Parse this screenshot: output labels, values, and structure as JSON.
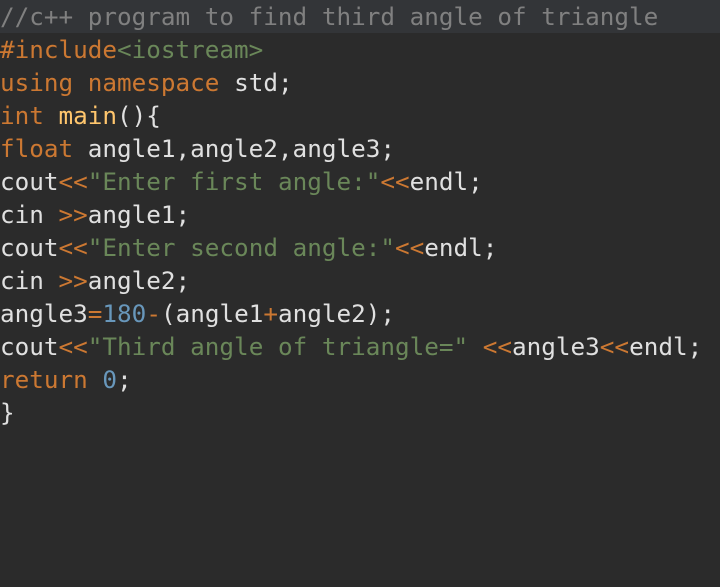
{
  "editor": {
    "colors": {
      "background": "#2b2b2b",
      "comment_line_bg": "#333538",
      "keyword": "#cc7832",
      "directive": "#cc7832",
      "header": "#6a8759",
      "string": "#6a8759",
      "number": "#6897bb",
      "operator": "#cc7832",
      "function": "#ffc66d",
      "comment": "#808080",
      "plain": "#e0e0e0"
    },
    "lines": [
      {
        "kind": "comment",
        "tokens": [
          {
            "t": "//c++ program to find third angle of triangle",
            "c": "comment"
          }
        ]
      },
      {
        "kind": "code",
        "tokens": [
          {
            "t": "#include",
            "c": "directive"
          },
          {
            "t": "<iostream>",
            "c": "header"
          }
        ]
      },
      {
        "kind": "code",
        "tokens": [
          {
            "t": "using",
            "c": "keyword"
          },
          {
            "t": " ",
            "c": "plain"
          },
          {
            "t": "namespace",
            "c": "keyword"
          },
          {
            "t": " std;",
            "c": "plain"
          }
        ]
      },
      {
        "kind": "code",
        "tokens": [
          {
            "t": "int",
            "c": "keyword"
          },
          {
            "t": " ",
            "c": "plain"
          },
          {
            "t": "main",
            "c": "function"
          },
          {
            "t": "(){",
            "c": "plain"
          }
        ]
      },
      {
        "kind": "code",
        "tokens": [
          {
            "t": "float",
            "c": "keyword"
          },
          {
            "t": " angle1,angle2,angle3;",
            "c": "plain"
          }
        ]
      },
      {
        "kind": "code",
        "tokens": [
          {
            "t": "cout",
            "c": "plain"
          },
          {
            "t": "<<",
            "c": "operator"
          },
          {
            "t": "\"Enter first angle:\"",
            "c": "string"
          },
          {
            "t": "<<",
            "c": "operator"
          },
          {
            "t": "endl;",
            "c": "plain"
          }
        ]
      },
      {
        "kind": "code",
        "tokens": [
          {
            "t": "cin ",
            "c": "plain"
          },
          {
            "t": ">>",
            "c": "operator"
          },
          {
            "t": "angle1;",
            "c": "plain"
          }
        ]
      },
      {
        "kind": "code",
        "tokens": [
          {
            "t": "cout",
            "c": "plain"
          },
          {
            "t": "<<",
            "c": "operator"
          },
          {
            "t": "\"Enter second angle:\"",
            "c": "string"
          },
          {
            "t": "<<",
            "c": "operator"
          },
          {
            "t": "endl;",
            "c": "plain"
          }
        ]
      },
      {
        "kind": "code",
        "tokens": [
          {
            "t": "cin ",
            "c": "plain"
          },
          {
            "t": ">>",
            "c": "operator"
          },
          {
            "t": "angle2;",
            "c": "plain"
          }
        ]
      },
      {
        "kind": "code",
        "tokens": [
          {
            "t": "angle3",
            "c": "plain"
          },
          {
            "t": "=",
            "c": "operator"
          },
          {
            "t": "180",
            "c": "number"
          },
          {
            "t": "-",
            "c": "operator"
          },
          {
            "t": "(angle1",
            "c": "plain"
          },
          {
            "t": "+",
            "c": "operator"
          },
          {
            "t": "angle2);",
            "c": "plain"
          }
        ]
      },
      {
        "kind": "code",
        "tokens": [
          {
            "t": "cout",
            "c": "plain"
          },
          {
            "t": "<<",
            "c": "operator"
          },
          {
            "t": "\"Third angle of triangle=\"",
            "c": "string"
          },
          {
            "t": " ",
            "c": "plain"
          },
          {
            "t": "<<",
            "c": "operator"
          },
          {
            "t": "angle3",
            "c": "plain"
          },
          {
            "t": "<<",
            "c": "operator"
          },
          {
            "t": "endl;",
            "c": "plain"
          }
        ]
      },
      {
        "kind": "code",
        "tokens": [
          {
            "t": "return",
            "c": "keyword"
          },
          {
            "t": " ",
            "c": "plain"
          },
          {
            "t": "0",
            "c": "number"
          },
          {
            "t": ";",
            "c": "plain"
          }
        ]
      },
      {
        "kind": "code",
        "tokens": [
          {
            "t": "}",
            "c": "plain"
          }
        ]
      }
    ]
  }
}
